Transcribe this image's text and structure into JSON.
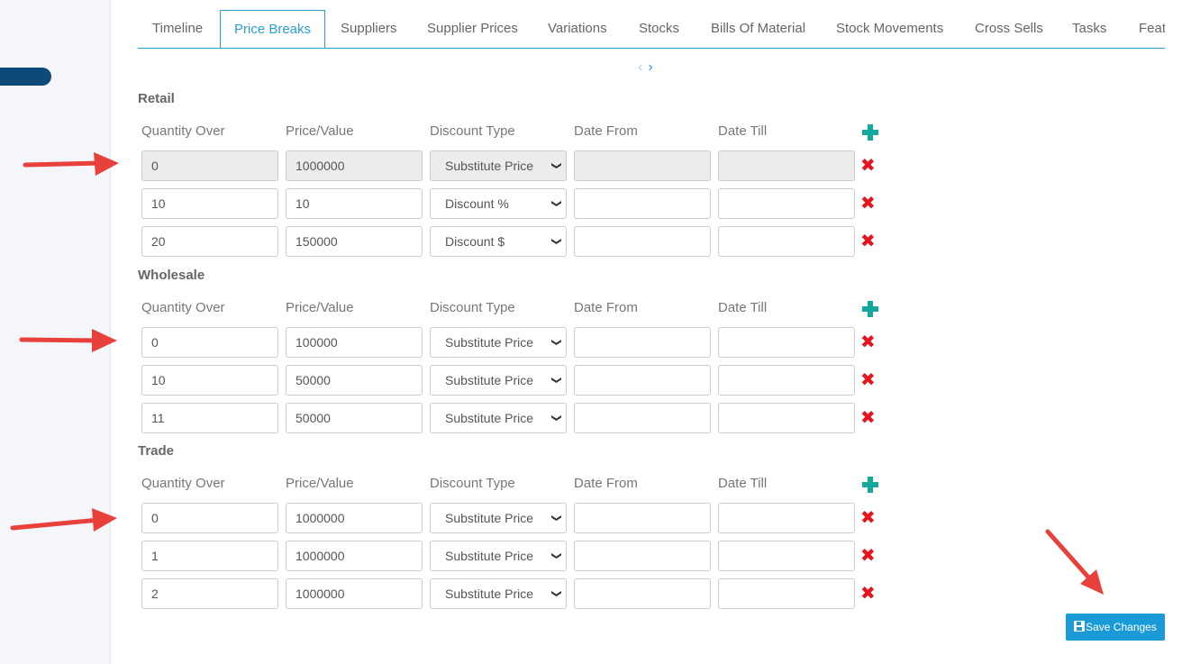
{
  "tabs": [
    "Timeline",
    "Price Breaks",
    "Suppliers",
    "Supplier Prices",
    "Variations",
    "Stocks",
    "Bills Of Material",
    "Stock Movements",
    "Cross Sells",
    "Tasks",
    "Feat"
  ],
  "active_tab": "Price Breaks",
  "pager": {
    "prev": "‹",
    "next": "›"
  },
  "columns": [
    "Quantity Over",
    "Price/Value",
    "Discount Type",
    "Date From",
    "Date Till"
  ],
  "sections": [
    {
      "title": "Retail",
      "rows": [
        {
          "qty": "0",
          "price": "1000000",
          "type": "Substitute Price",
          "from": "",
          "till": "",
          "disabled": true
        },
        {
          "qty": "10",
          "price": "10",
          "type": "Discount %",
          "from": "",
          "till": ""
        },
        {
          "qty": "20",
          "price": "150000",
          "type": "Discount $",
          "from": "",
          "till": ""
        }
      ]
    },
    {
      "title": "Wholesale",
      "rows": [
        {
          "qty": "0",
          "price": "100000",
          "type": "Substitute Price",
          "from": "",
          "till": ""
        },
        {
          "qty": "10",
          "price": "50000",
          "type": "Substitute Price",
          "from": "",
          "till": ""
        },
        {
          "qty": "11",
          "price": "50000",
          "type": "Substitute Price",
          "from": "",
          "till": ""
        }
      ]
    },
    {
      "title": "Trade",
      "rows": [
        {
          "qty": "0",
          "price": "1000000",
          "type": "Substitute Price",
          "from": "",
          "till": ""
        },
        {
          "qty": "1",
          "price": "1000000",
          "type": "Substitute Price",
          "from": "",
          "till": ""
        },
        {
          "qty": "2",
          "price": "1000000",
          "type": "Substitute Price",
          "from": "",
          "till": ""
        }
      ]
    }
  ],
  "save_label": "Save Changes",
  "icons": {
    "add": "plus-icon",
    "remove": "close-icon",
    "save": "floppy-icon"
  },
  "colors": {
    "accent": "#1a9ad6",
    "add": "#13a89e",
    "remove": "#e8141c",
    "annotation": "#e8403a"
  }
}
